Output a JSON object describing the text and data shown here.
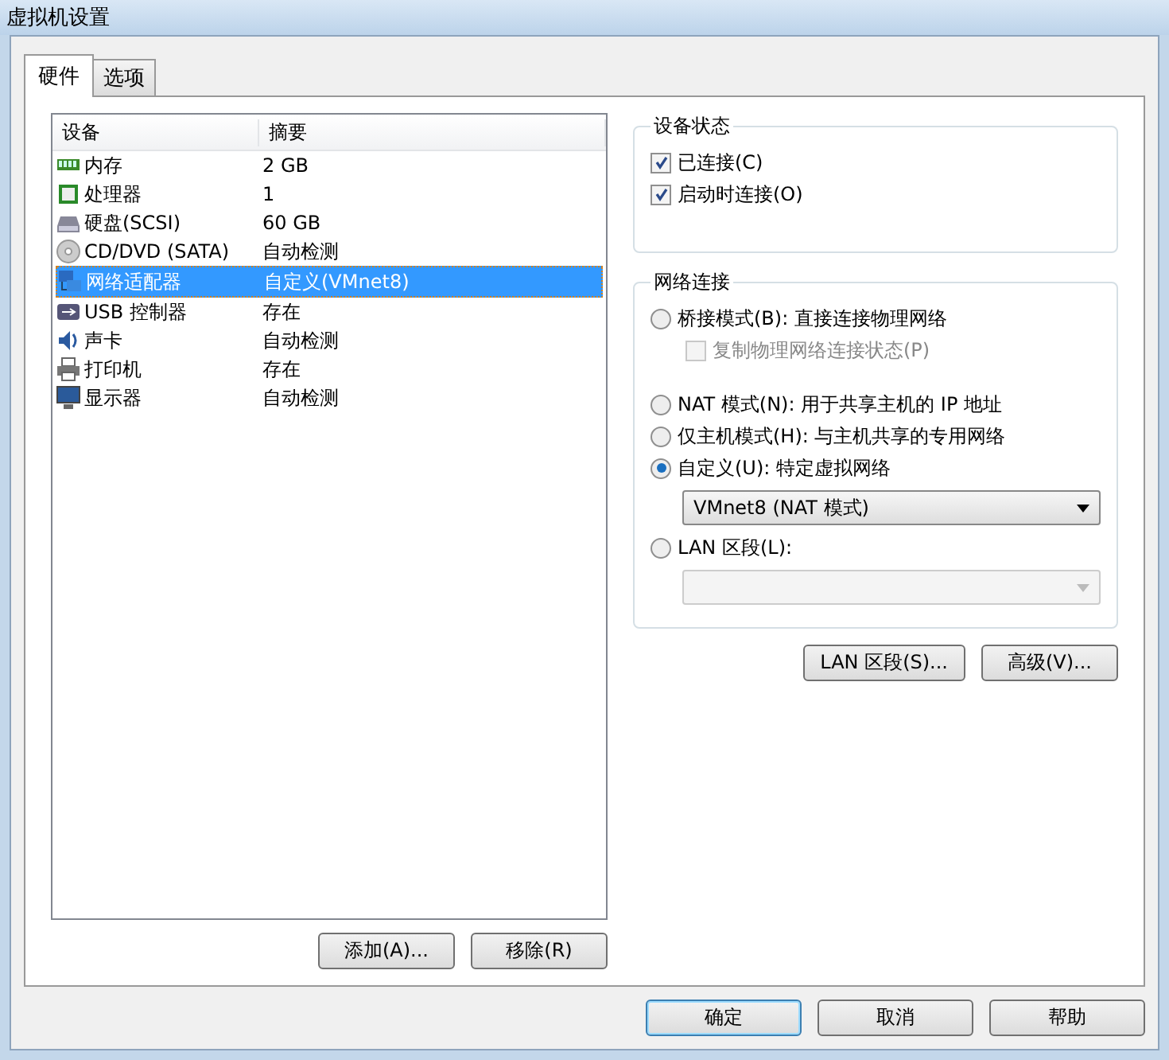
{
  "window": {
    "title": "虚拟机设置"
  },
  "tabs": [
    {
      "label": "硬件",
      "selected": true
    },
    {
      "label": "选项",
      "selected": false
    }
  ],
  "devices": {
    "columns": [
      "设备",
      "摘要"
    ],
    "rows": [
      {
        "kind": "memory",
        "name": "内存",
        "summary": "2 GB",
        "selected": false
      },
      {
        "kind": "cpu",
        "name": "处理器",
        "summary": "1",
        "selected": false
      },
      {
        "kind": "disk",
        "name": "硬盘(SCSI)",
        "summary": "60 GB",
        "selected": false
      },
      {
        "kind": "cd",
        "name": "CD/DVD (SATA)",
        "summary": "自动检测",
        "selected": false
      },
      {
        "kind": "network",
        "name": "网络适配器",
        "summary": "自定义(VMnet8)",
        "selected": true
      },
      {
        "kind": "usb",
        "name": "USB 控制器",
        "summary": "存在",
        "selected": false
      },
      {
        "kind": "sound",
        "name": "声卡",
        "summary": "自动检测",
        "selected": false
      },
      {
        "kind": "printer",
        "name": "打印机",
        "summary": "存在",
        "selected": false
      },
      {
        "kind": "display",
        "name": "显示器",
        "summary": "自动检测",
        "selected": false
      }
    ]
  },
  "list_buttons": [
    "添加(A)...",
    "移除(R)"
  ],
  "device_status": {
    "title": "设备状态",
    "options": [
      {
        "label": "已连接(C)",
        "checked": true,
        "disabled": false
      },
      {
        "label": "启动时连接(O)",
        "checked": true,
        "disabled": false
      }
    ]
  },
  "network_connection": {
    "title": "网络连接",
    "items": [
      {
        "kind": "radio",
        "label": "桥接模式(B): 直接连接物理网络",
        "selected": false
      },
      {
        "kind": "checkbox",
        "label": "复制物理网络连接状态(P)",
        "checked": false,
        "disabled": true
      },
      {
        "kind": "radio",
        "label": "NAT 模式(N): 用于共享主机的 IP 地址",
        "selected": false
      },
      {
        "kind": "radio",
        "label": "仅主机模式(H): 与主机共享的专用网络",
        "selected": false
      },
      {
        "kind": "radio",
        "label": "自定义(U): 特定虚拟网络",
        "selected": true
      },
      {
        "kind": "select",
        "value": "VMnet8 (NAT 模式)",
        "disabled": false
      },
      {
        "kind": "radio",
        "label": "LAN 区段(L):",
        "selected": false
      },
      {
        "kind": "select",
        "disabled": true
      }
    ]
  },
  "network_buttons": [
    "LAN 区段(S)...",
    "高级(V)..."
  ],
  "dialog_buttons": [
    {
      "label": "确定",
      "default": true
    },
    {
      "label": "取消",
      "default": false
    },
    {
      "label": "帮助",
      "default": false
    }
  ]
}
